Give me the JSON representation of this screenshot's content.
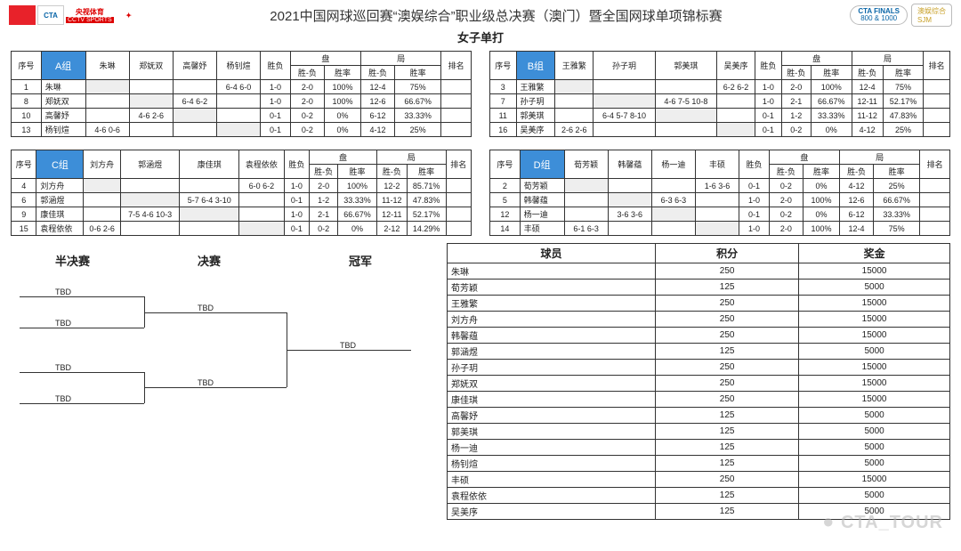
{
  "header": {
    "logo_cta": "CTA",
    "cctv_top": "央视体育",
    "cctv_bot": "CCTV SPORTS",
    "title": "2021中国网球巡回赛“澳娱综合”职业级总决赛（澳门）暨全国网球单项锦标赛",
    "finals_top": "CTA FINALS",
    "finals_bot": "800 & 1000",
    "sjm_top": "澳娱综合",
    "sjm_bot": "SJM"
  },
  "subtitle": "女子单打",
  "common_headers": {
    "seq": "序号",
    "wl": "胜负",
    "set": "盘",
    "game": "局",
    "rank": "排名",
    "sub_wl": "胜-负",
    "sub_rate": "胜率"
  },
  "groups": [
    {
      "label": "A组",
      "players": [
        "朱琳",
        "郑妩双",
        "高馨妤",
        "杨钊煊"
      ],
      "rows": [
        {
          "n": "1",
          "name": "朱琳",
          "cells": [
            "",
            "",
            "",
            "6-4 6-0"
          ],
          "wl": "1-0",
          "swl": "2-0",
          "sr": "100%",
          "gwl": "12-4",
          "gr": "75%"
        },
        {
          "n": "8",
          "name": "郑妩双",
          "cells": [
            "",
            "",
            "6-4 6-2",
            ""
          ],
          "wl": "1-0",
          "swl": "2-0",
          "sr": "100%",
          "gwl": "12-6",
          "gr": "66.67%"
        },
        {
          "n": "10",
          "name": "高馨妤",
          "cells": [
            "",
            "4-6 2-6",
            "",
            ""
          ],
          "wl": "0-1",
          "swl": "0-2",
          "sr": "0%",
          "gwl": "6-12",
          "gr": "33.33%"
        },
        {
          "n": "13",
          "name": "杨钊煊",
          "cells": [
            "4-6 0-6",
            "",
            "",
            ""
          ],
          "wl": "0-1",
          "swl": "0-2",
          "sr": "0%",
          "gwl": "4-12",
          "gr": "25%"
        }
      ]
    },
    {
      "label": "B组",
      "players": [
        "王雅繁",
        "孙子玥",
        "郭美琪",
        "吴美序"
      ],
      "rows": [
        {
          "n": "3",
          "name": "王雅繁",
          "cells": [
            "",
            "",
            "",
            "6-2 6-2"
          ],
          "wl": "1-0",
          "swl": "2-0",
          "sr": "100%",
          "gwl": "12-4",
          "gr": "75%"
        },
        {
          "n": "7",
          "name": "孙子玥",
          "cells": [
            "",
            "",
            "4-6 7-5 10-8",
            ""
          ],
          "wl": "1-0",
          "swl": "2-1",
          "sr": "66.67%",
          "gwl": "12-11",
          "gr": "52.17%"
        },
        {
          "n": "11",
          "name": "郭美琪",
          "cells": [
            "",
            "6-4 5-7 8-10",
            "",
            ""
          ],
          "wl": "0-1",
          "swl": "1-2",
          "sr": "33.33%",
          "gwl": "11-12",
          "gr": "47.83%"
        },
        {
          "n": "16",
          "name": "吴美序",
          "cells": [
            "2-6 2-6",
            "",
            "",
            ""
          ],
          "wl": "0-1",
          "swl": "0-2",
          "sr": "0%",
          "gwl": "4-12",
          "gr": "25%"
        }
      ]
    },
    {
      "label": "C组",
      "players": [
        "刘方舟",
        "郭涵煜",
        "康佳琪",
        "袁程依依"
      ],
      "rows": [
        {
          "n": "4",
          "name": "刘方舟",
          "cells": [
            "",
            "",
            "",
            "6-0 6-2"
          ],
          "wl": "1-0",
          "swl": "2-0",
          "sr": "100%",
          "gwl": "12-2",
          "gr": "85.71%"
        },
        {
          "n": "6",
          "name": "郭涵煜",
          "cells": [
            "",
            "",
            "5-7 6-4  3-10",
            ""
          ],
          "wl": "0-1",
          "swl": "1-2",
          "sr": "33.33%",
          "gwl": "11-12",
          "gr": "47.83%"
        },
        {
          "n": "9",
          "name": "康佳琪",
          "cells": [
            "",
            "7-5 4-6  10-3",
            "",
            ""
          ],
          "wl": "1-0",
          "swl": "2-1",
          "sr": "66.67%",
          "gwl": "12-11",
          "gr": "52.17%"
        },
        {
          "n": "15",
          "name": "袁程依依",
          "cells": [
            "0-6 2-6",
            "",
            "",
            ""
          ],
          "wl": "0-1",
          "swl": "0-2",
          "sr": "0%",
          "gwl": "2-12",
          "gr": "14.29%"
        }
      ]
    },
    {
      "label": "D组",
      "players": [
        "荀芳颖",
        "韩馨蕴",
        "杨一迪",
        "丰硕"
      ],
      "rows": [
        {
          "n": "2",
          "name": "荀芳颖",
          "cells": [
            "",
            "",
            "",
            "1-6 3-6"
          ],
          "wl": "0-1",
          "swl": "0-2",
          "sr": "0%",
          "gwl": "4-12",
          "gr": "25%"
        },
        {
          "n": "5",
          "name": "韩馨蕴",
          "cells": [
            "",
            "",
            "6-3 6-3",
            ""
          ],
          "wl": "1-0",
          "swl": "2-0",
          "sr": "100%",
          "gwl": "12-6",
          "gr": "66.67%"
        },
        {
          "n": "12",
          "name": "杨一迪",
          "cells": [
            "",
            "3-6 3-6",
            "",
            ""
          ],
          "wl": "0-1",
          "swl": "0-2",
          "sr": "0%",
          "gwl": "6-12",
          "gr": "33.33%"
        },
        {
          "n": "14",
          "name": "丰硕",
          "cells": [
            "6-1 6-3",
            "",
            "",
            ""
          ],
          "wl": "1-0",
          "swl": "2-0",
          "sr": "100%",
          "gwl": "12-4",
          "gr": "75%"
        }
      ]
    }
  ],
  "bracket": {
    "semi": "半决赛",
    "final": "决赛",
    "champ": "冠军",
    "tbd": "TBD"
  },
  "standings": {
    "h_player": "球员",
    "h_points": "积分",
    "h_prize": "奖金",
    "rows": [
      {
        "p": "朱琳",
        "pts": "250",
        "pr": "15000"
      },
      {
        "p": "荀芳颖",
        "pts": "125",
        "pr": "5000"
      },
      {
        "p": "王雅繁",
        "pts": "250",
        "pr": "15000"
      },
      {
        "p": "刘方舟",
        "pts": "250",
        "pr": "15000"
      },
      {
        "p": "韩馨蕴",
        "pts": "250",
        "pr": "15000"
      },
      {
        "p": "郭涵煜",
        "pts": "125",
        "pr": "5000"
      },
      {
        "p": "孙子玥",
        "pts": "250",
        "pr": "15000"
      },
      {
        "p": "郑妩双",
        "pts": "250",
        "pr": "15000"
      },
      {
        "p": "康佳琪",
        "pts": "250",
        "pr": "15000"
      },
      {
        "p": "高馨妤",
        "pts": "125",
        "pr": "5000"
      },
      {
        "p": "郭美琪",
        "pts": "125",
        "pr": "5000"
      },
      {
        "p": "杨一迪",
        "pts": "125",
        "pr": "5000"
      },
      {
        "p": "杨钊煊",
        "pts": "125",
        "pr": "5000"
      },
      {
        "p": "丰硕",
        "pts": "250",
        "pr": "15000"
      },
      {
        "p": "袁程依依",
        "pts": "125",
        "pr": "5000"
      },
      {
        "p": "吴美序",
        "pts": "125",
        "pr": "5000"
      }
    ]
  },
  "watermark": "CTA_TOUR"
}
